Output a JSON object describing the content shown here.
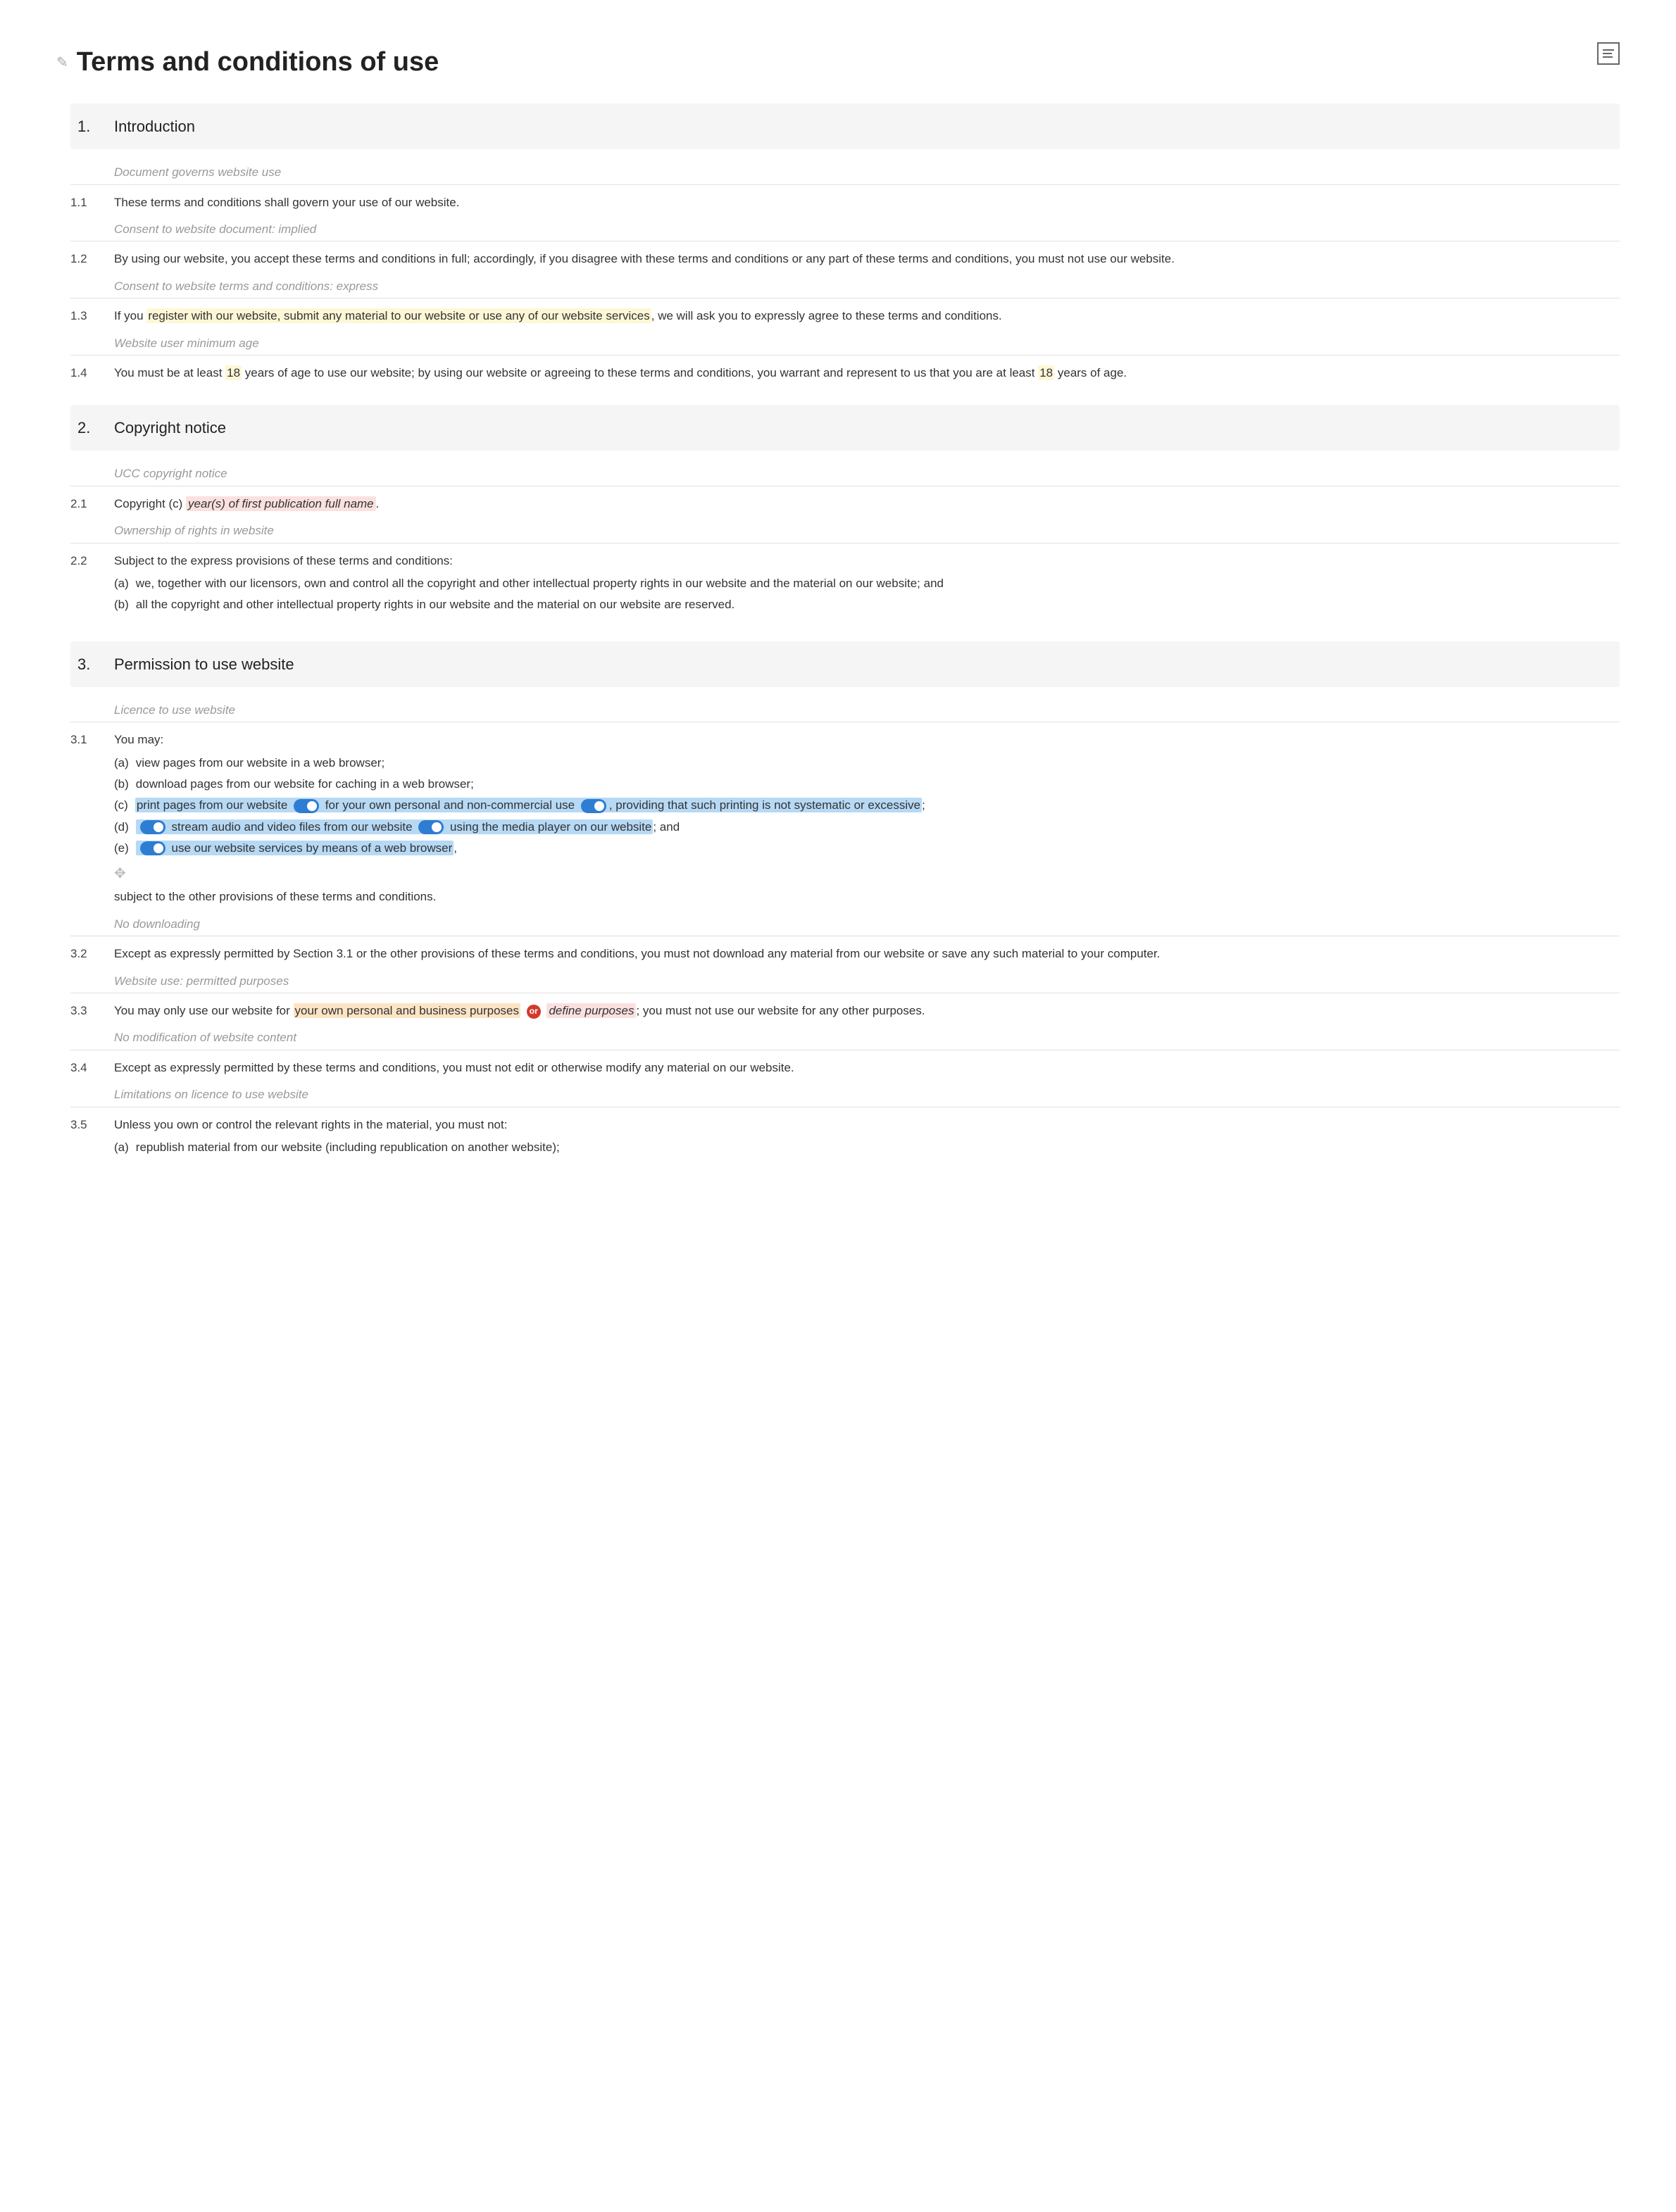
{
  "title": "Terms and conditions of use",
  "or_label": "or",
  "sections": [
    {
      "num": "1.",
      "label": "Introduction"
    },
    {
      "num": "2.",
      "label": "Copyright notice"
    },
    {
      "num": "3.",
      "label": "Permission to use website"
    }
  ],
  "notes": {
    "n0": "Document governs website use",
    "n1": "Consent to website document: implied",
    "n2": "Consent to website terms and conditions: express",
    "n3": "Website user minimum age",
    "n4": "UCC copyright notice",
    "n5": "Ownership of rights in website",
    "n6": "Licence to use website",
    "n7": "No downloading",
    "n8": "Website use: permitted purposes",
    "n9": "No modification of website content",
    "n10": "Limitations on licence to use website"
  },
  "clauses": {
    "c11": {
      "num": "1.1",
      "text": "These terms and conditions shall govern your use of our website."
    },
    "c12": {
      "num": "1.2",
      "text": "By using our website, you accept these terms and conditions in full; accordingly, if you disagree with these terms and conditions or any part of these terms and conditions, you must not use our website."
    },
    "c13": {
      "num": "1.3",
      "pre": "If you ",
      "hl": "register with our website, submit any material to our website or use any of our website services",
      "post": ", we will ask you to expressly agree to these terms and conditions."
    },
    "c14": {
      "num": "1.4",
      "p1": "You must be at least ",
      "age1": "18",
      "p2": " years of age to use our website; by using our website or agreeing to these terms and conditions, you warrant and represent to us that you are at least ",
      "age2": "18",
      "p3": " years of age."
    },
    "c21": {
      "num": "2.1",
      "pre": "Copyright (c) ",
      "placeholder": "year(s) of first publication full name",
      "post": "."
    },
    "c22": {
      "num": "2.2",
      "intro": "Subject to the express provisions of these terms and conditions:",
      "a": "we, together with our licensors, own and control all the copyright and other intellectual property rights in our website and the material on our website; and",
      "b": "all the copyright and other intellectual property rights in our website and the material on our website are reserved."
    },
    "c31": {
      "num": "3.1",
      "intro": "You may:",
      "a": "view pages from our website in a web browser;",
      "b": "download pages from our website for caching in a web browser;",
      "c_pre": "print pages from our website",
      "c_mid1": " for your own personal and non-commercial use ",
      "c_mid2": ", providing that such printing is not systematic or excessive",
      "c_post": ";",
      "d_pre": "",
      "d_mid1": " stream audio and video files from our website ",
      "d_mid2": " using the media player on our website",
      "d_post": "; and",
      "e_pre": "",
      "e_mid": " use our website services by means of a web browser",
      "e_post": ",",
      "tail": "subject to the other provisions of these terms and conditions."
    },
    "c32": {
      "num": "3.2",
      "text": "Except as expressly permitted by Section 3.1 or the other provisions of these terms and conditions, you must not download any material from our website or save any such material to your computer."
    },
    "c33": {
      "num": "3.3",
      "pre": "You may only use our website for ",
      "opt1": "your own personal and business purposes",
      "opt2": "define purposes",
      "post": "; you must not use our website for any other purposes."
    },
    "c34": {
      "num": "3.4",
      "text": "Except as expressly permitted by these terms and conditions, you must not edit or otherwise modify any material on our website."
    },
    "c35": {
      "num": "3.5",
      "intro": "Unless you own or control the relevant rights in the material, you must not:",
      "a": "republish material from our website (including republication on another website);"
    }
  },
  "letters": {
    "a": "(a)",
    "b": "(b)",
    "c": "(c)",
    "d": "(d)",
    "e": "(e)"
  }
}
